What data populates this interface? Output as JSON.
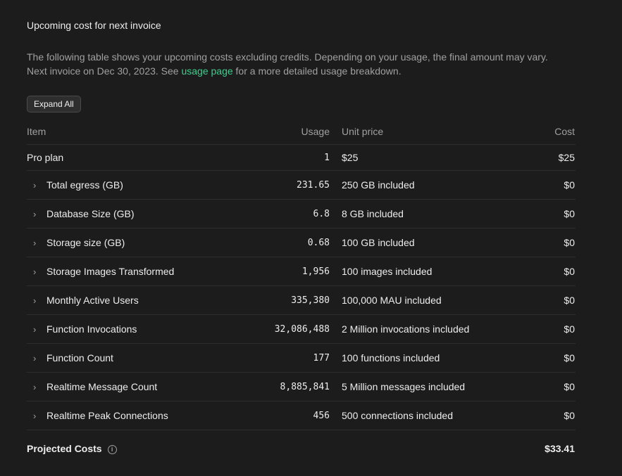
{
  "header": {
    "title": "Upcoming cost for next invoice",
    "desc_line1": "The following table shows your upcoming costs excluding credits. Depending on your usage, the final amount may vary.",
    "desc_prefix": "Next invoice on Dec 30, 2023. See ",
    "desc_link": "usage page",
    "desc_suffix": " for a more detailed usage breakdown.",
    "expand_label": "Expand All"
  },
  "table": {
    "columns": {
      "item": "Item",
      "usage": "Usage",
      "unit_price": "Unit price",
      "cost": "Cost"
    },
    "plan": {
      "item": "Pro plan",
      "usage": "1",
      "unit_price": "$25",
      "cost": "$25"
    },
    "rows": [
      {
        "item": "Total egress (GB)",
        "usage": "231.65",
        "unit_price": "250 GB included",
        "cost": "$0"
      },
      {
        "item": "Database Size (GB)",
        "usage": "6.8",
        "unit_price": "8 GB included",
        "cost": "$0"
      },
      {
        "item": "Storage size (GB)",
        "usage": "0.68",
        "unit_price": "100 GB included",
        "cost": "$0"
      },
      {
        "item": "Storage Images Transformed",
        "usage": "1,956",
        "unit_price": "100 images included",
        "cost": "$0"
      },
      {
        "item": "Monthly Active Users",
        "usage": "335,380",
        "unit_price": "100,000 MAU included",
        "cost": "$0"
      },
      {
        "item": "Function Invocations",
        "usage": "32,086,488",
        "unit_price": "2 Million invocations included",
        "cost": "$0"
      },
      {
        "item": "Function Count",
        "usage": "177",
        "unit_price": "100 functions included",
        "cost": "$0"
      },
      {
        "item": "Realtime Message Count",
        "usage": "8,885,841",
        "unit_price": "5 Million messages included",
        "cost": "$0"
      },
      {
        "item": "Realtime Peak Connections",
        "usage": "456",
        "unit_price": "500 connections included",
        "cost": "$0"
      }
    ],
    "total": {
      "label": "Projected Costs",
      "cost": "$33.41"
    }
  },
  "icons": {
    "chevron": "chevron-right-icon",
    "info": "info-icon"
  }
}
